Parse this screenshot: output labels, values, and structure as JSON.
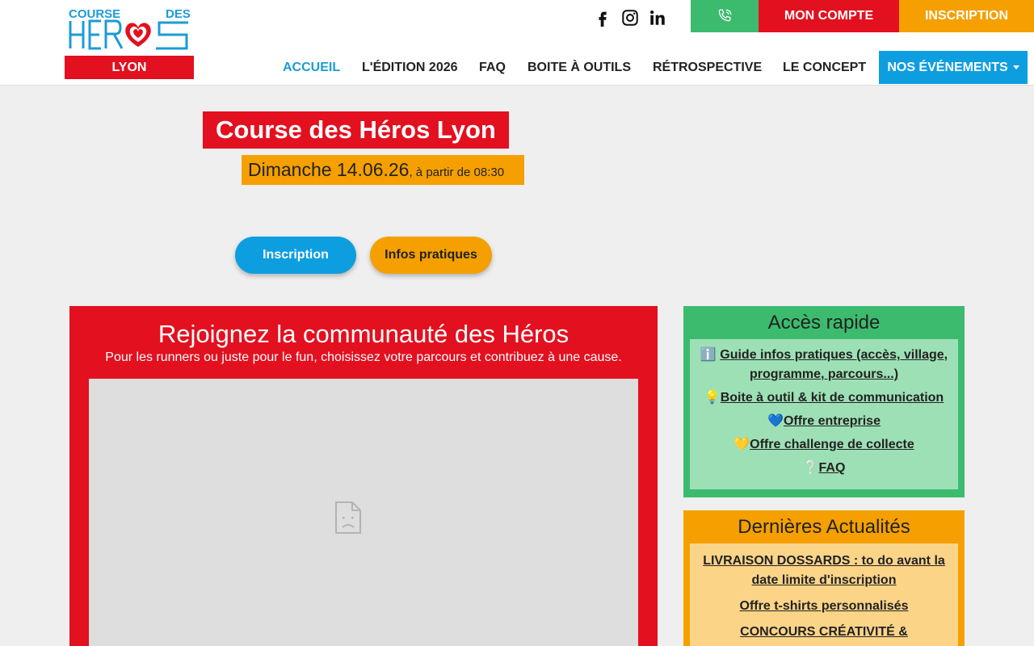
{
  "header": {
    "logo": {
      "line1_left": "COURSE",
      "line1_right": "DES",
      "word": "HEROS",
      "city": "LYON"
    },
    "social": [
      "facebook-icon",
      "instagram-icon",
      "linkedin-icon"
    ],
    "top_buttons": {
      "account": "MON COMPTE",
      "signup": "INSCRIPTION"
    },
    "nav": [
      "ACCUEIL",
      "L'ÉDITION 2026",
      "FAQ",
      "BOITE À OUTILS",
      "RÉTROSPECTIVE",
      "LE CONCEPT"
    ],
    "nav_events": "NOS ÉVÉNEMENTS",
    "colors": {
      "red": "#e3101f",
      "orange": "#f5a000",
      "green": "#3cbb6e",
      "blue": "#0d9ee0"
    }
  },
  "hero": {
    "title": "Course des Héros Lyon",
    "date_main": "Dimanche 14.06.26",
    "date_suffix": ", à partir de 08:30",
    "btn_signup": "Inscription",
    "btn_info": "Infos pratiques"
  },
  "community": {
    "title": "Rejoignez la communauté des Héros",
    "subtitle": "Pour les runners ou juste pour le fun, choisissez votre parcours et contribuez à une cause."
  },
  "quick_access": {
    "title": "Accès rapide",
    "items": [
      {
        "emoji": "ℹ️ ",
        "label": "Guide infos pratiques (accès, village, programme, parcours...)"
      },
      {
        "emoji": "💡",
        "label": "Boite à outil & kit de communication"
      },
      {
        "emoji": "💙",
        "label": "Offre entreprise"
      },
      {
        "emoji": "💛",
        "label": "Offre challenge de collecte"
      },
      {
        "emoji": "❔",
        "label": "FAQ"
      }
    ]
  },
  "news": {
    "title": "Dernières Actualités",
    "items": [
      "LIVRAISON DOSSARDS : to do avant la date limite d'inscription",
      "Offre t-shirts personnalisés",
      "CONCOURS CRÉATIVITÉ &"
    ]
  }
}
